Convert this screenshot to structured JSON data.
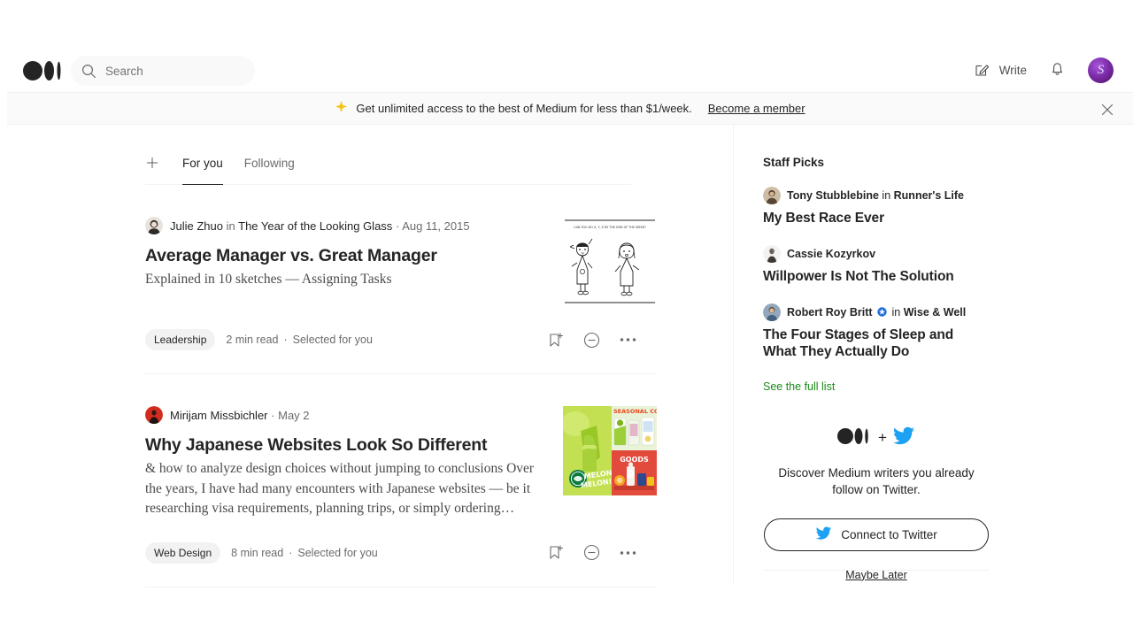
{
  "header": {
    "logo_icon": "medium-logo-icon",
    "search": {
      "placeholder": "Search",
      "value": ""
    },
    "write_label": "Write",
    "write_icon": "pencil-square-icon",
    "bell_icon": "bell-icon",
    "avatar_label": "S"
  },
  "banner": {
    "sparkle_icon": "sparkle-icon",
    "text": "Get unlimited access to the best of Medium for less than $1/week.",
    "link": "Become a member",
    "close_icon": "close-icon"
  },
  "tabs": {
    "add_icon": "plus-icon",
    "items": [
      {
        "label": "For you",
        "active": true
      },
      {
        "label": "Following",
        "active": false
      }
    ]
  },
  "articles": [
    {
      "author": "Julie Zhuo",
      "in_word": "in",
      "publication": "The Year of the Looking Glass",
      "separator": "·",
      "date": "Aug 11, 2015",
      "title": "Average Manager vs. Great Manager",
      "subtitle": "Explained in 10 sketches — Assigning Tasks",
      "tag": "Leadership",
      "read_time": "2 min read",
      "meta_sep": "·",
      "recommendation": "Selected for you",
      "thumbnail_alt": "sketch-two-figures",
      "thumbnail_caption": "CAN YOU DO X, Y, Z BY THE END OF THE WEEK?",
      "bookmark_icon": "bookmark-add-icon",
      "mute_icon": "minus-circle-icon",
      "more_icon": "ellipsis-icon"
    },
    {
      "author": "Mirijam Missbichler",
      "in_word": "",
      "publication": "",
      "separator": "·",
      "date": "May 2",
      "title": "Why Japanese Websites Look So Different",
      "subtitle": "& how to analyze design choices without jumping to conclusions Over the years, I have had many encounters with Japanese websites — be it researching visa requirements, planning trips, or simply ordering…",
      "tag": "Web Design",
      "read_time": "8 min read",
      "meta_sep": "·",
      "recommendation": "Selected for you",
      "thumbnail_alt": "japanese-website-collage",
      "thumbnail_labels": {
        "melon": "MELON MELON",
        "seasonal": "SEASONAL CO",
        "goods": "GOODS"
      },
      "bookmark_icon": "bookmark-add-icon",
      "mute_icon": "minus-circle-icon",
      "more_icon": "ellipsis-icon"
    }
  ],
  "sidebar": {
    "staff_picks_title": "Staff Picks",
    "picks": [
      {
        "author": "Tony Stubblebine",
        "in_word": "in",
        "publication": "Runner's Life",
        "verified": false,
        "title": "My Best Race Ever"
      },
      {
        "author": "Cassie Kozyrkov",
        "in_word": "",
        "publication": "",
        "verified": false,
        "title": "Willpower Is Not The Solution"
      },
      {
        "author": "Robert Roy Britt",
        "in_word": "in",
        "publication": "Wise & Well",
        "verified": true,
        "title": "The Four Stages of Sleep and What They Actually Do"
      }
    ],
    "see_full_list": "See the full list",
    "twitter": {
      "plus": "+",
      "medium_icon": "medium-logo-icon",
      "twitter_icon": "twitter-bird-icon",
      "description": "Discover Medium writers you already follow on Twitter.",
      "connect_label": "Connect to Twitter",
      "maybe_later": "Maybe Later"
    }
  },
  "colors": {
    "accent_green": "#1a8917",
    "twitter_blue": "#1da1f2",
    "banner_gold": "#f5c518",
    "text_primary": "#242424",
    "text_muted": "#6b6b6b",
    "verified_blue": "#1d6ed8"
  }
}
